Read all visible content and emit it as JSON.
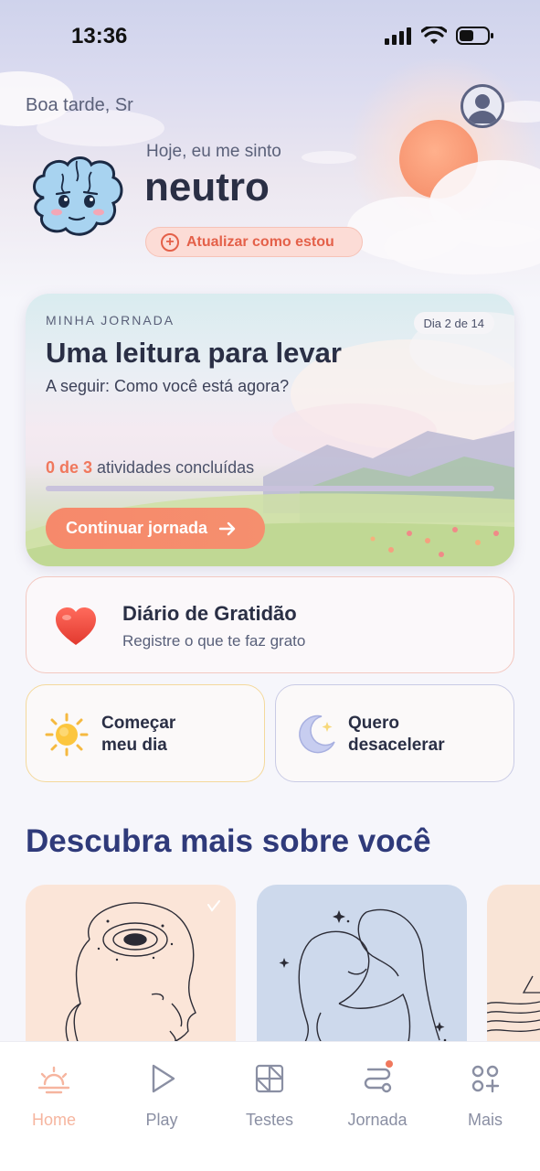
{
  "status_bar": {
    "time": "13:36"
  },
  "header": {
    "greeting": "Boa tarde, Sr",
    "feeling_label": "Hoje, eu me sinto",
    "feeling_value": "neutro",
    "update_button": "Atualizar como estou"
  },
  "journey": {
    "kicker": "MINHA JORNADA",
    "day_badge": "Dia 2 de 14",
    "title": "Uma leitura para levar",
    "next": "A seguir: Como você está agora?",
    "progress_count": "0 de 3",
    "progress_suffix": "atividades concluídas",
    "progress_fraction": 0,
    "continue_button": "Continuar jornada"
  },
  "gratitude": {
    "title": "Diário de Gratidão",
    "subtitle": "Registre o que te faz grato"
  },
  "quick_actions": [
    {
      "line1": "Começar",
      "line2": "meu dia",
      "icon": "sun-icon"
    },
    {
      "line1": "Quero",
      "line2": "desacelerar",
      "icon": "moon-icon"
    }
  ],
  "discover": {
    "title": "Descubra mais sobre você"
  },
  "tabs": [
    {
      "label": "Home",
      "icon": "sunrise-icon",
      "active": true
    },
    {
      "label": "Play",
      "icon": "play-icon",
      "active": false
    },
    {
      "label": "Testes",
      "icon": "grid-icon",
      "active": false
    },
    {
      "label": "Jornada",
      "icon": "path-icon",
      "active": false
    },
    {
      "label": "Mais",
      "icon": "more-icon",
      "active": false
    }
  ],
  "colors": {
    "accent": "#f0785d",
    "primary_text": "#2a2f45",
    "section_title": "#2f3a7a"
  }
}
